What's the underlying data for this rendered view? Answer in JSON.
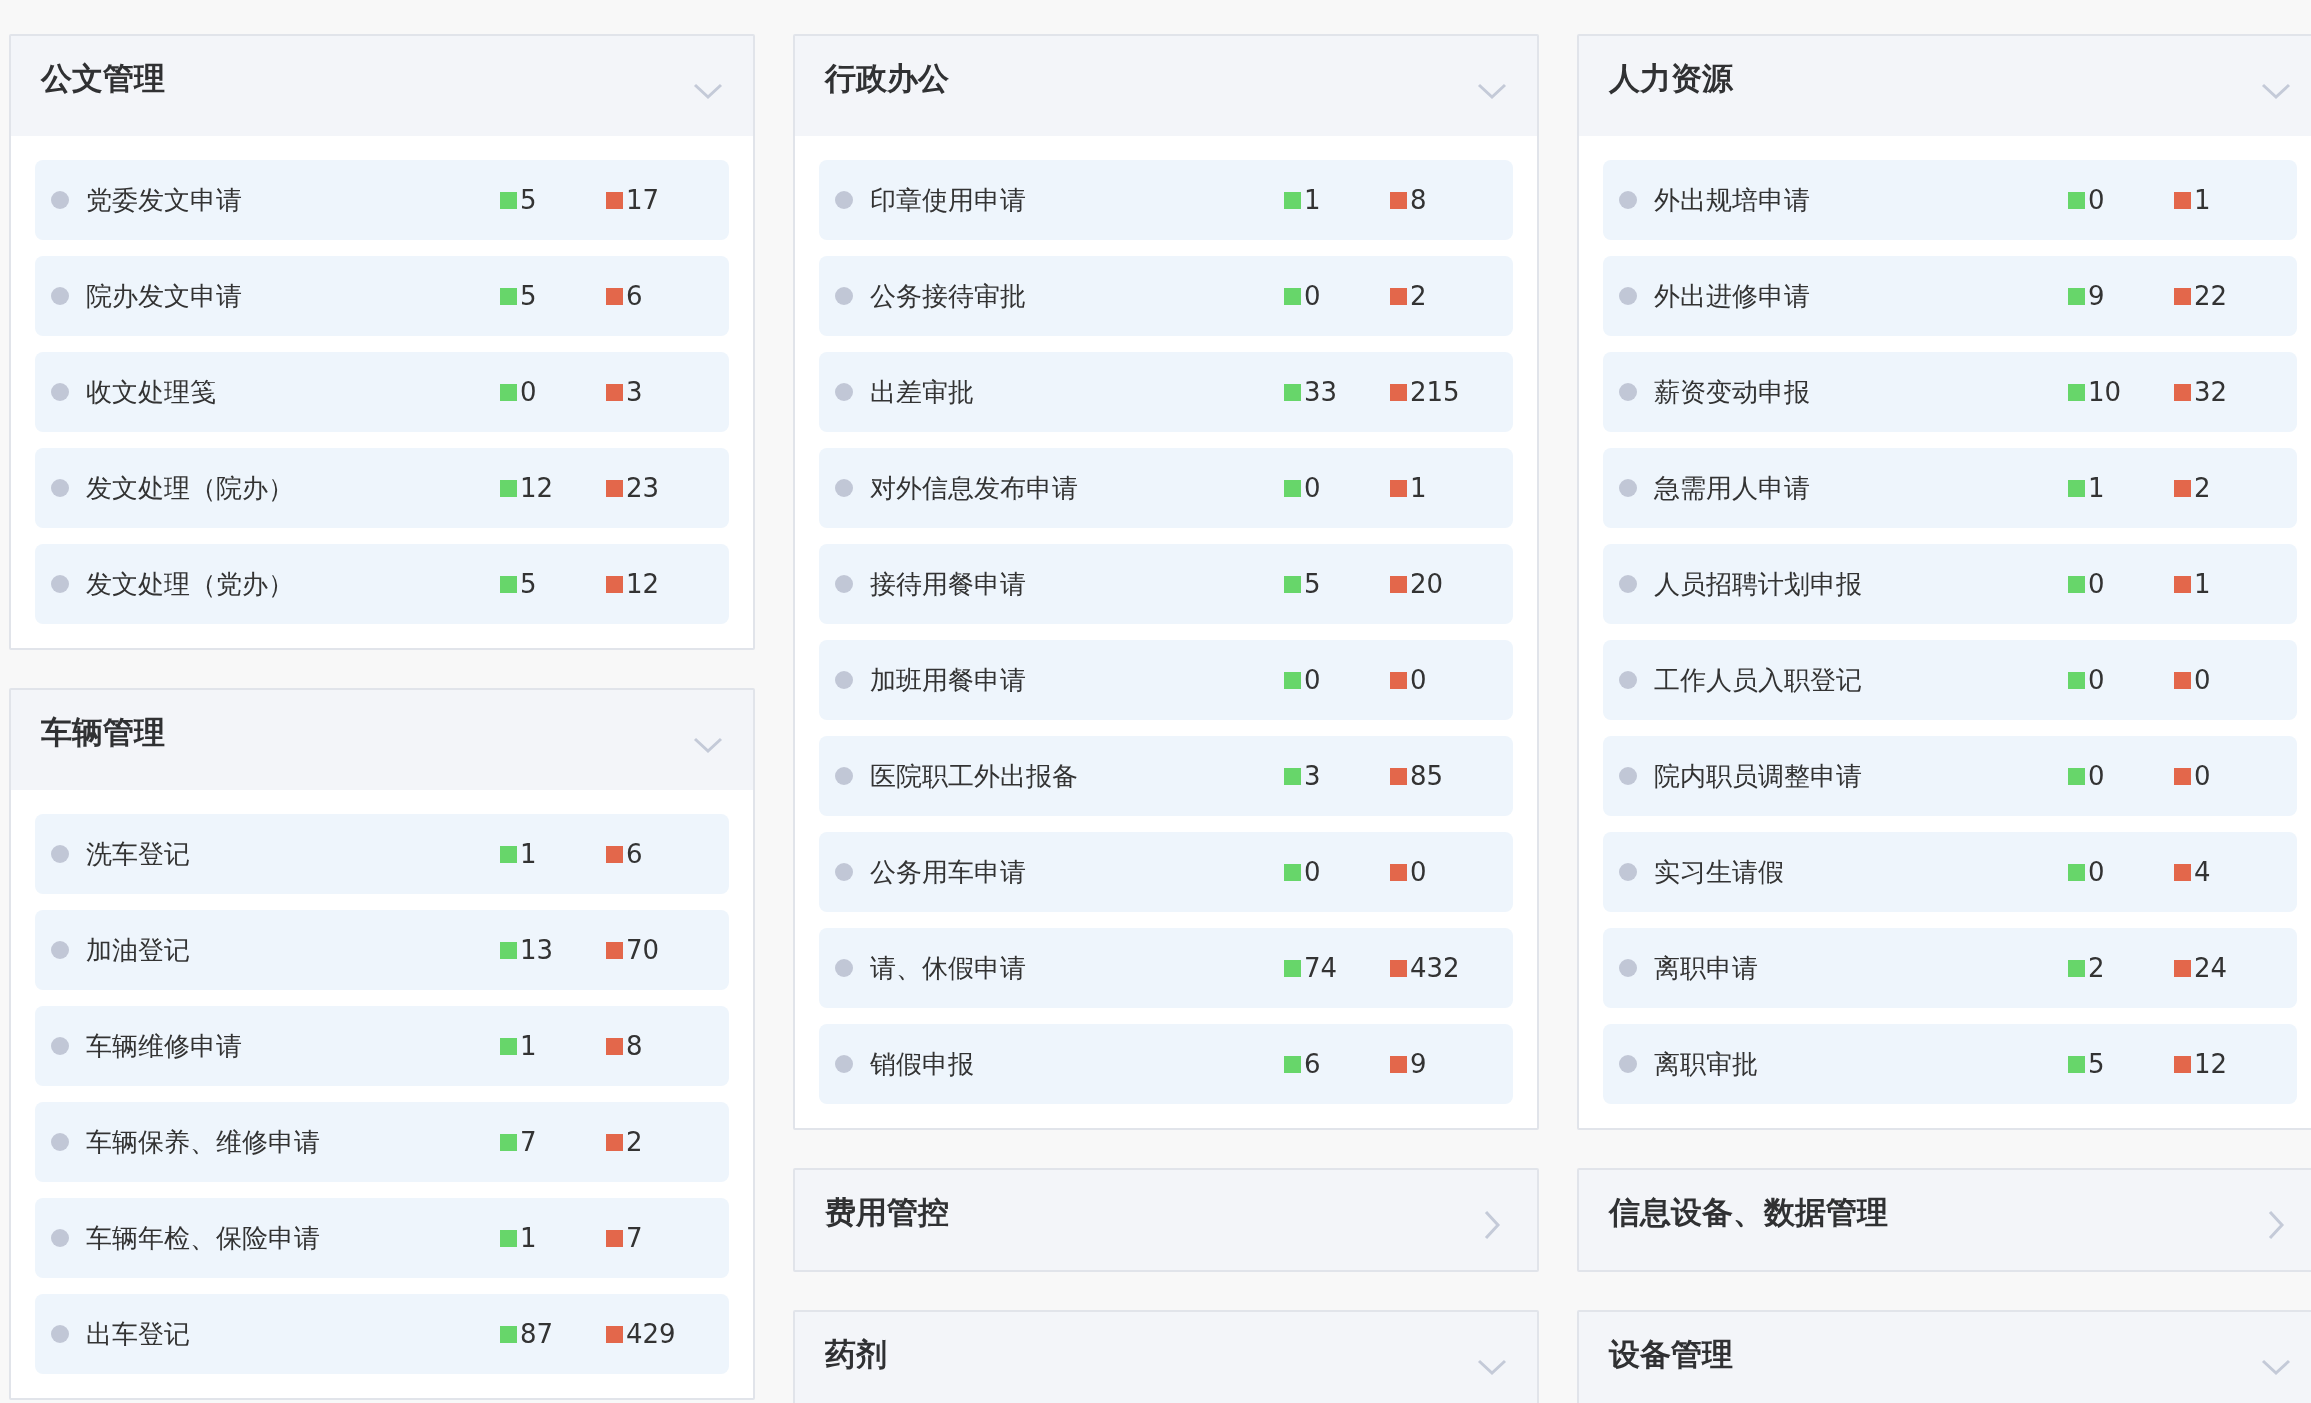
{
  "columns": [
    {
      "panels": [
        {
          "title": "公文管理",
          "expanded": true,
          "items": [
            {
              "name": "党委发文申请",
              "count_1": "5",
              "count_2": "17"
            },
            {
              "name": "院办发文申请",
              "count_1": "5",
              "count_2": "6"
            },
            {
              "name": "收文处理笺",
              "count_1": "0",
              "count_2": "3"
            },
            {
              "name": "发文处理（院办）",
              "count_1": "12",
              "count_2": "23"
            },
            {
              "name": "发文处理（党办）",
              "count_1": "5",
              "count_2": "12"
            }
          ]
        },
        {
          "title": "车辆管理",
          "expanded": true,
          "items": [
            {
              "name": "洗车登记",
              "count_1": "1",
              "count_2": "6"
            },
            {
              "name": "加油登记",
              "count_1": "13",
              "count_2": "70"
            },
            {
              "name": "车辆维修申请",
              "count_1": "1",
              "count_2": "8"
            },
            {
              "name": "车辆保养、维修申请",
              "count_1": "7",
              "count_2": "2"
            },
            {
              "name": "车辆年检、保险申请",
              "count_1": "1",
              "count_2": "7"
            },
            {
              "name": "出车登记",
              "count_1": "87",
              "count_2": "429"
            }
          ]
        }
      ]
    },
    {
      "panels": [
        {
          "title": "行政办公",
          "expanded": true,
          "items": [
            {
              "name": "印章使用申请",
              "count_1": "1",
              "count_2": "8"
            },
            {
              "name": "公务接待审批",
              "count_1": "0",
              "count_2": "2"
            },
            {
              "name": "出差审批",
              "count_1": "33",
              "count_2": "215"
            },
            {
              "name": "对外信息发布申请",
              "count_1": "0",
              "count_2": "1"
            },
            {
              "name": "接待用餐申请",
              "count_1": "5",
              "count_2": "20"
            },
            {
              "name": "加班用餐申请",
              "count_1": "0",
              "count_2": "0"
            },
            {
              "name": "医院职工外出报备",
              "count_1": "3",
              "count_2": "85"
            },
            {
              "name": "公务用车申请",
              "count_1": "0",
              "count_2": "0"
            },
            {
              "name": "请、休假申请",
              "count_1": "74",
              "count_2": "432"
            },
            {
              "name": "销假申报",
              "count_1": "6",
              "count_2": "9"
            }
          ]
        },
        {
          "title": "费用管控",
          "expanded": false
        },
        {
          "title": "药剂",
          "expanded": true
        }
      ]
    },
    {
      "panels": [
        {
          "title": "人力资源",
          "expanded": true,
          "items": [
            {
              "name": "外出规培申请",
              "count_1": "0",
              "count_2": "1"
            },
            {
              "name": "外出进修申请",
              "count_1": "9",
              "count_2": "22"
            },
            {
              "name": "薪资变动申报",
              "count_1": "10",
              "count_2": "32"
            },
            {
              "name": "急需用人申请",
              "count_1": "1",
              "count_2": "2"
            },
            {
              "name": "人员招聘计划申报",
              "count_1": "0",
              "count_2": "1"
            },
            {
              "name": "工作人员入职登记",
              "count_1": "0",
              "count_2": "0"
            },
            {
              "name": "院内职员调整申请",
              "count_1": "0",
              "count_2": "0"
            },
            {
              "name": "实习生请假",
              "count_1": "0",
              "count_2": "4"
            },
            {
              "name": "离职申请",
              "count_1": "2",
              "count_2": "24"
            },
            {
              "name": "离职审批",
              "count_1": "5",
              "count_2": "12"
            }
          ]
        },
        {
          "title": "信息设备、数据管理",
          "expanded": false
        },
        {
          "title": "设备管理",
          "expanded": true
        }
      ]
    }
  ]
}
